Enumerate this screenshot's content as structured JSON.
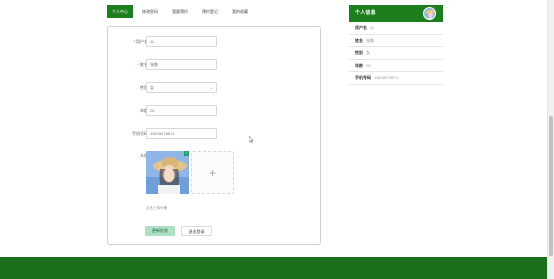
{
  "tabs": [
    {
      "label": "个人中心",
      "active": true
    },
    {
      "label": "修改密码",
      "active": false
    },
    {
      "label": "我要预约",
      "active": false
    },
    {
      "label": "预约登记",
      "active": false
    },
    {
      "label": "我的收藏",
      "active": false
    }
  ],
  "form": {
    "username": {
      "label": "用户名",
      "value": "11"
    },
    "name": {
      "label": "姓名",
      "value": "张鹏"
    },
    "gender": {
      "label": "性别",
      "value": "女"
    },
    "age": {
      "label": "年龄",
      "value": "25"
    },
    "phone": {
      "label": "手机号码",
      "value": "15678578571"
    },
    "avatar": {
      "label": "头像"
    },
    "hint": "点击上传头像",
    "update_button": "更新信息",
    "logout_button": "退出登录"
  },
  "profile": {
    "title": "个人信息",
    "rows": [
      {
        "key": "用户名",
        "value": "11"
      },
      {
        "key": "姓名",
        "value": "张鹏"
      },
      {
        "key": "性别",
        "value": "女"
      },
      {
        "key": "年龄",
        "value": "25"
      },
      {
        "key": "手机号码",
        "value": "15678578571"
      }
    ]
  },
  "colors": {
    "brand_green": "#1e7e1e",
    "button_green": "#aee1c4",
    "footer_green": "#1b6f1b"
  },
  "icons": {
    "select_arrow": "chevron-down-icon",
    "upload": "plus-icon",
    "uploaded_badge": "check-icon"
  }
}
